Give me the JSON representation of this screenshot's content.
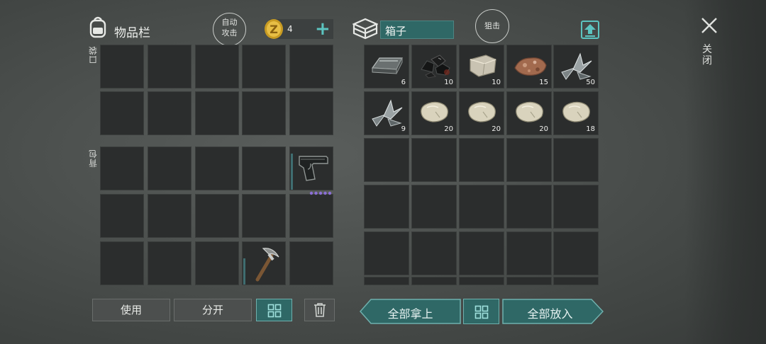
{
  "inventory": {
    "title": "物品栏",
    "auto_attack_label": "自动攻击",
    "coins": "4",
    "pocket_label": "口袋",
    "backpack_label": "背包"
  },
  "container": {
    "title": "箱子",
    "snipe_label": "狙击",
    "items": [
      {
        "icon": "iron-ingot-icon",
        "count": "6"
      },
      {
        "icon": "coal-icon",
        "count": "10"
      },
      {
        "icon": "limestone-icon",
        "count": "10"
      },
      {
        "icon": "iron-ore-icon",
        "count": "15"
      },
      {
        "icon": "scrap-metal-icon",
        "count": "50"
      },
      {
        "icon": "scrap-metal-icon",
        "count": "9"
      },
      {
        "icon": "stone-icon",
        "count": "20"
      },
      {
        "icon": "stone-icon",
        "count": "20"
      },
      {
        "icon": "stone-icon",
        "count": "20"
      },
      {
        "icon": "stone-icon",
        "count": "18"
      }
    ]
  },
  "actions": {
    "use": "使用",
    "split": "分开",
    "take_all": "全部拿上",
    "put_all": "全部放入"
  },
  "close_label": "关闭",
  "colors": {
    "accent_teal": "#2f6866",
    "teal_border": "#6fb0ad",
    "rarity_dots": "#8b6fd6"
  }
}
